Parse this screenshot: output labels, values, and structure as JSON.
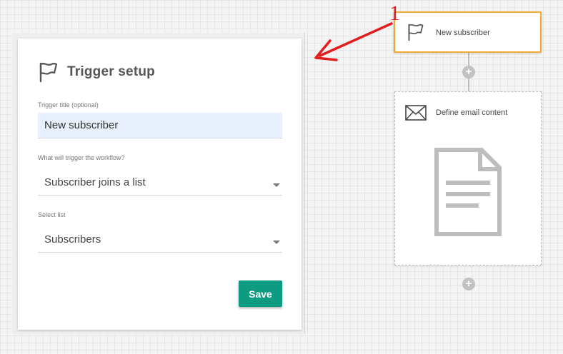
{
  "trigger_setup": {
    "title": "Trigger setup",
    "title_field": {
      "label": "Trigger title (optional)",
      "value": "New subscriber"
    },
    "trigger_field": {
      "label": "What will trigger the workflow?",
      "value": "Subscriber joins a list"
    },
    "list_field": {
      "label": "Select list",
      "value": "Subscribers"
    },
    "save_label": "Save"
  },
  "workflow": {
    "trigger_node": {
      "label": "New subscriber"
    },
    "email_node": {
      "label": "Define email content"
    },
    "add_step_symbol": "+"
  },
  "annotation": {
    "number": "1"
  },
  "colors": {
    "accent_button": "#0f9a82",
    "selected_node_border": "#f3a92b",
    "annotation": "#e11d1d",
    "input_fill": "#e8f0fe"
  },
  "icons": {
    "panel_header": "flag-icon",
    "trigger_node": "flag-icon",
    "email_node": "envelope-icon",
    "email_preview": "document-icon",
    "dropdown": "caret-down-icon",
    "add_step": "plus-icon"
  }
}
